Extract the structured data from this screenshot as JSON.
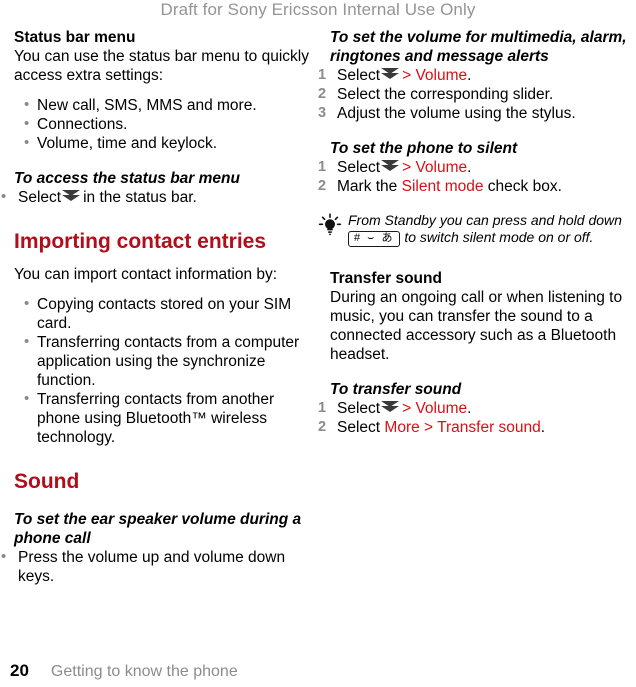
{
  "watermark": "Draft for Sony Ericsson Internal Use Only",
  "icons": {
    "status_bar_chevron": "double-chevron-down-icon",
    "tip_bulb": "light-bulb-icon"
  },
  "left_column": {
    "status_bar_menu": {
      "heading": "Status bar menu",
      "intro": "You can use the status bar menu to quickly access extra settings:",
      "bullets": [
        "New call, SMS, MMS and more.",
        "Connections.",
        "Volume, time and keylock."
      ]
    },
    "access_status_bar": {
      "heading": "To access the status bar menu",
      "step_before": "Select",
      "step_after": "in the status bar."
    },
    "importing": {
      "heading": "Importing contact entries",
      "intro": "You can import contact information by:",
      "bullets": [
        "Copying contacts stored on your SIM card.",
        "Transferring contacts from a computer application using the synchronize function.",
        "Transferring contacts from another phone using Bluetooth™ wireless technology."
      ]
    },
    "sound": {
      "heading": "Sound",
      "ear_speaker": {
        "heading": "To set the ear speaker volume during a phone call",
        "step": "Press the volume up and volume down keys."
      }
    }
  },
  "right_column": {
    "set_volume": {
      "heading": "To set the volume for multimedia, alarm, ringtones and message alerts",
      "step1_before": "Select",
      "step1_path": "> Volume",
      "step1_after": ".",
      "step2": "Select the corresponding slider.",
      "step3": "Adjust the volume using the stylus."
    },
    "silent": {
      "heading": "To set the phone to silent",
      "step1_before": "Select",
      "step1_path": "> Volume",
      "step1_after": ".",
      "step2_before": "Mark the",
      "step2_path": "Silent mode",
      "step2_after": "check box."
    },
    "tip": {
      "text_before": "From Standby you can press and hold down",
      "keycap": "# ⌣ あ",
      "text_after": "to switch silent mode on or off."
    },
    "transfer": {
      "heading": "Transfer sound",
      "body": "During an ongoing call or when listening to music, you can transfer the sound to a connected accessory such as a Bluetooth headset.",
      "proc_heading": "To transfer sound",
      "step1_before": "Select",
      "step1_path": "> Volume",
      "step1_after": ".",
      "step2_before": "Select",
      "step2_path": "More > Transfer sound",
      "step2_after": "."
    }
  },
  "footer": {
    "page_number": "20",
    "chapter": "Getting to know the phone"
  },
  "colors": {
    "chapter_heading": "#B00E1A",
    "inline_red": "#D81016",
    "watermark_gray": "#949494",
    "bullet_gray": "#8a8a8a",
    "step_number_gray": "#8c8c8c"
  }
}
